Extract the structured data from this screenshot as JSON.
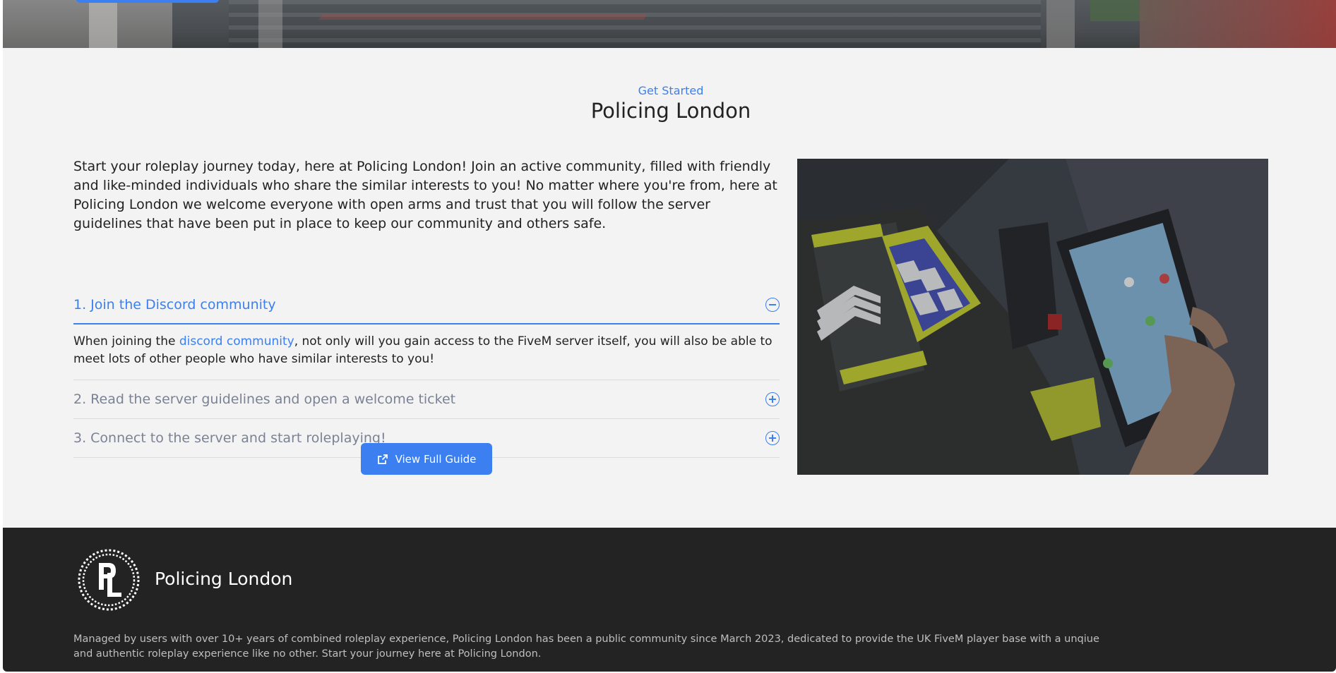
{
  "section": {
    "eyebrow": "Get Started",
    "title": "Policing London",
    "intro": "Start your roleplay journey today, here at Policing London! Join an active community, filled with friendly and like-minded individuals who share the similar interests to you! No matter where you're from, here at Policing London we welcome everyone with open arms and trust that you will follow the server guidelines that have been put in place to keep our community and others safe."
  },
  "accordion": {
    "items": [
      {
        "label": "1. Join the Discord community",
        "expanded": true,
        "body_prefix": "When joining the ",
        "body_link": "discord community",
        "body_suffix": ", not only will you gain access to the FiveM server itself, you will also be able to meet lots of other people who have similar interests to you!"
      },
      {
        "label": "2. Read the server guidelines and open a welcome ticket",
        "expanded": false
      },
      {
        "label": "3. Connect to the server and start roleplaying!",
        "expanded": false
      }
    ]
  },
  "guide_button": {
    "label": "View Full Guide",
    "icon": "external-link-icon"
  },
  "photo": {
    "subject": "police-officer-using-tablet"
  },
  "footer": {
    "brand": "Policing London",
    "logo_letters": "PL",
    "description": "Managed by users with over 10+ years of combined roleplay experience, Policing London has been a public community since March 2023, dedicated to provide the UK FiveM player base with a unqiue and authentic roleplay experience like no other. Start your journey here at Policing London."
  },
  "colors": {
    "accent": "#3b7ff0",
    "text": "#222222",
    "muted": "#7b8294",
    "section_bg": "#f3f3f3",
    "footer_bg": "#232323"
  }
}
